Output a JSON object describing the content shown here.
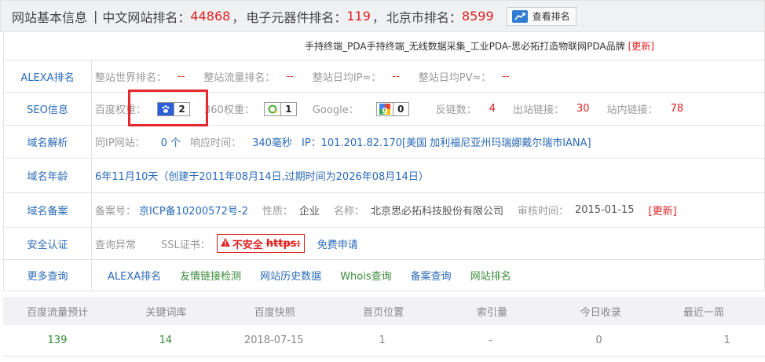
{
  "header": {
    "title": "网站基本信息",
    "separator": "|",
    "cn_rank_label": "中文网站排名：",
    "cn_rank_value": "44868",
    "cat_rank_label": "电子元器件排名：",
    "cat_rank_value": "119",
    "city_rank_label": "北京市排名：",
    "city_rank_value": "8599",
    "comma": "，",
    "view_rank_button": "查看排名"
  },
  "site_title": {
    "text": "手持终端_PDA手持终端_无线数据采集_工业PDA-思必拓打造物联网PDA品牌",
    "update_link": "[更新]"
  },
  "alexa": {
    "label": "ALEXA排名",
    "world_rank_label": "整站世界排名：",
    "world_rank_value": "--",
    "traffic_rank_label": "整站流量排名：",
    "traffic_rank_value": "--",
    "daily_ip_label": "整站日均IP≈：",
    "daily_ip_value": "--",
    "daily_pv_label": "整站日均PV≈：",
    "daily_pv_value": "--"
  },
  "seo": {
    "label": "SEO信息",
    "baidu_label": "百度权重：",
    "baidu_value": "2",
    "so360_label": "360权重：",
    "so360_value": "1",
    "google_label": "Google：",
    "google_value": "0",
    "backlinks_label": "反链数：",
    "backlinks_value": "4",
    "outlinks_label": "出站链接：",
    "outlinks_value": "30",
    "inlinks_label": "站内链接：",
    "inlinks_value": "78"
  },
  "dns": {
    "label": "域名解析",
    "same_ip_label": "同IP网站：",
    "same_ip_value": "0 个",
    "response_label": "响应时间：",
    "response_value": "340毫秒",
    "ip_label": "IP：",
    "ip_value": "101.201.82.170[美国 加利福尼亚州玛瑞娜戴尔瑞市IANA]"
  },
  "age": {
    "label": "域名年龄",
    "value": "6年11月10天（创建于2011年08月14日,过期时间为2026年08月14日）"
  },
  "icp": {
    "label": "域名备案",
    "no_label": "备案号：",
    "no_value": "京ICP备10200572号-2",
    "nature_label": "性质：",
    "nature_value": "企业",
    "name_label": "名称：",
    "name_value": "北京思必拓科技股份有限公司",
    "audit_label": "审核时间：",
    "audit_value": "2015-01-15",
    "update_link": "[更新]"
  },
  "security": {
    "label": "安全认证",
    "query_status": "查询异常",
    "ssl_label": "SSL证书：",
    "ssl_badge_text": "不安全",
    "ssl_badge_proto": "https:",
    "free_apply": "免费申请"
  },
  "more": {
    "label": "更多查询",
    "links": [
      "ALEXA排名",
      "友情链接检测",
      "网站历史数据",
      "Whois查询",
      "备案查询",
      "网站排名"
    ]
  },
  "stats": {
    "headers": [
      "百度流量预计",
      "关键词库",
      "百度快照",
      "首页位置",
      "索引量",
      "今日收录",
      "最近一周"
    ],
    "values": [
      "139",
      "14",
      "2018-07-15",
      "1",
      "-",
      "0",
      "1"
    ]
  },
  "colors": {
    "accent_red": "#e02020",
    "link_blue": "#2a6ab8",
    "green": "#3a8a3a",
    "highlight": "#e8282d"
  }
}
